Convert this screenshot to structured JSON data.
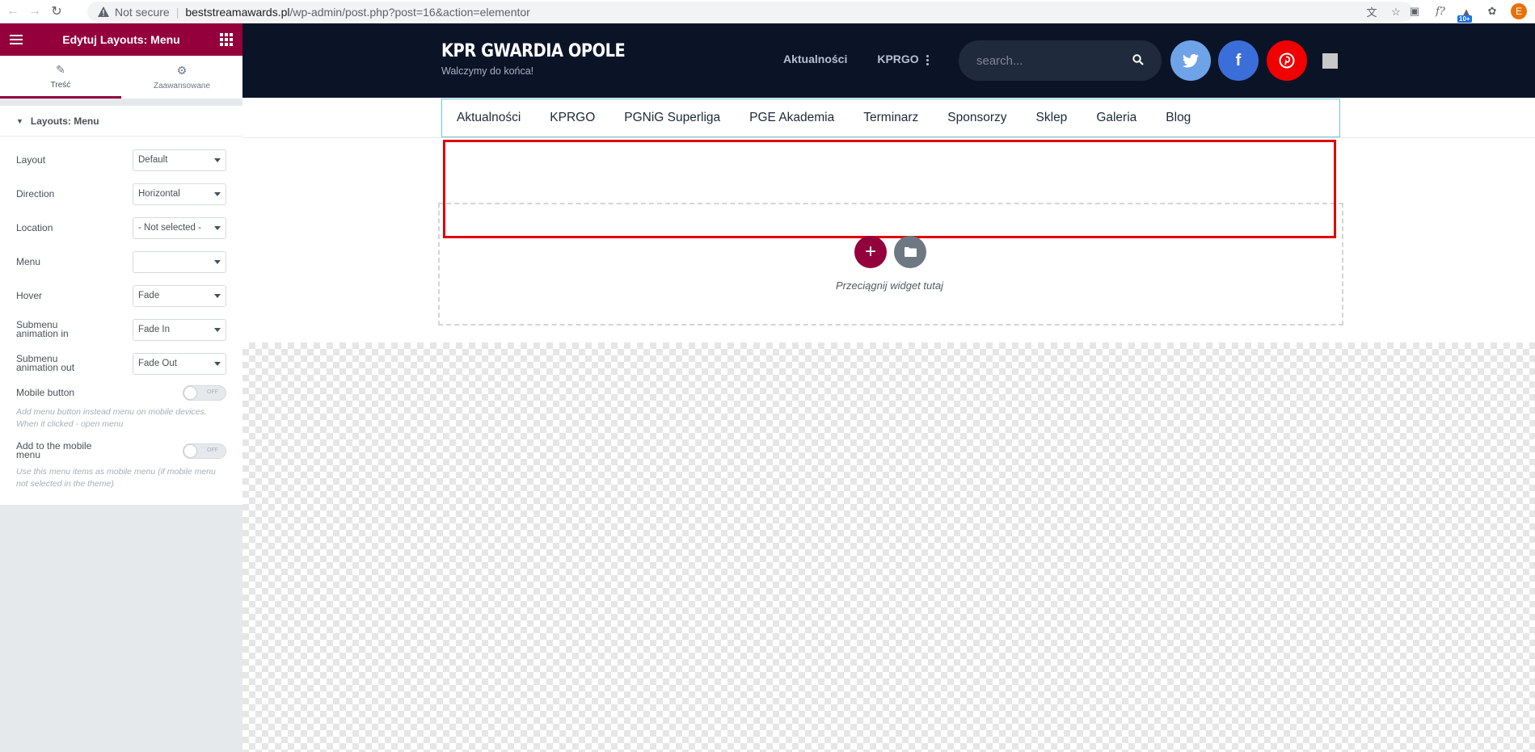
{
  "browser": {
    "security_label": "Not secure",
    "url_host": "beststreamawards.pl",
    "url_path": "/wp-admin/post.php?post=16&action=elementor",
    "extension_badge": "10+",
    "profile_initial": "E",
    "fx_label": "f?"
  },
  "panel": {
    "title": "Edytuj Layouts: Menu",
    "tabs": [
      {
        "label": "Treść",
        "icon": "pencil-icon"
      },
      {
        "label": "Zaawansowane",
        "icon": "gear-icon"
      }
    ],
    "section_title": "Layouts: Menu",
    "controls": [
      {
        "label": "Layout",
        "value": "Default"
      },
      {
        "label": "Direction",
        "value": "Horizontal"
      },
      {
        "label": "Location",
        "value": "- Not selected -"
      },
      {
        "label": "Menu",
        "value": ""
      },
      {
        "label": "Hover",
        "value": "Fade"
      },
      {
        "label": "Submenu animation in",
        "value": "Fade In"
      },
      {
        "label": "Submenu animation out",
        "value": "Fade Out"
      }
    ],
    "mobile_button": {
      "label": "Mobile button",
      "state": "OFF",
      "description": "Add menu button instead menu on mobile devices. When it clicked - open menu"
    },
    "mobile_menu": {
      "label": "Add to the mobile menu",
      "state": "OFF",
      "description": "Use this menu items as mobile menu (if mobile menu not selected in the theme)"
    }
  },
  "site": {
    "logo": "KPR GWARDIA OPOLE",
    "tagline": "Walczymy do końca!",
    "top_nav": [
      "Aktualności",
      "KPRGO"
    ],
    "search_placeholder": "search...",
    "social": [
      {
        "name": "twitter",
        "color": "#6fa3e8"
      },
      {
        "name": "facebook",
        "color": "#3b6ed9"
      },
      {
        "name": "pinterest",
        "color": "#f00000"
      }
    ],
    "menu": [
      "Aktualności",
      "KPRGO",
      "PGNiG Superliga",
      "PGE Akademia",
      "Terminarz",
      "Sponsorzy",
      "Sklep",
      "Galeria",
      "Blog"
    ],
    "drop_text": "Przeciągnij widget tutaj"
  },
  "colors": {
    "accent": "#93003c",
    "header_bg": "#0b1427",
    "highlight": "#e00000"
  }
}
